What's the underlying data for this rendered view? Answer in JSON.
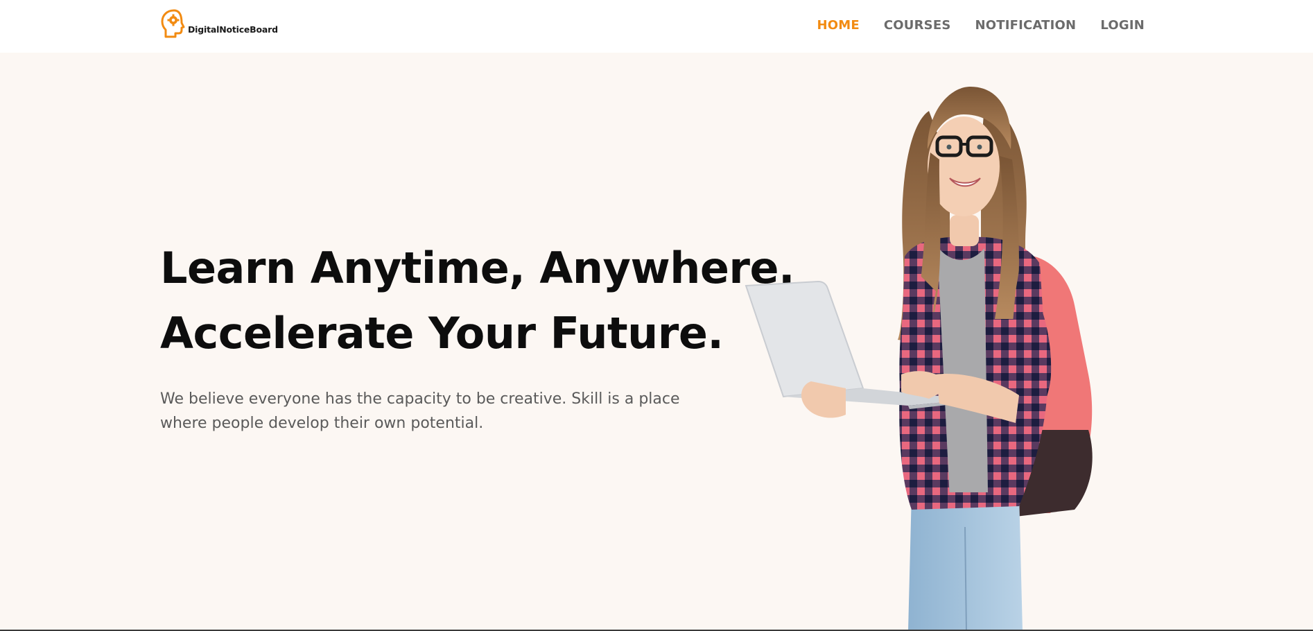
{
  "brand": {
    "name": "DigitalNoticeBoard",
    "logo_icon": "head-gear-icon",
    "accent_color": "#f28b12"
  },
  "nav": {
    "items": [
      {
        "label": "HOME",
        "active": true
      },
      {
        "label": "COURSES",
        "active": false
      },
      {
        "label": "NOTIFICATION",
        "active": false
      },
      {
        "label": "LOGIN",
        "active": false
      }
    ]
  },
  "hero": {
    "headline_line1": "Learn Anytime, Anywhere.",
    "headline_line2": "Accelerate Your Future.",
    "description": "We believe everyone has the capacity to be creative. Skill is a place where people develop their own potential.",
    "image": "student-with-laptop-illustration",
    "background_color": "#fcf7f3"
  }
}
